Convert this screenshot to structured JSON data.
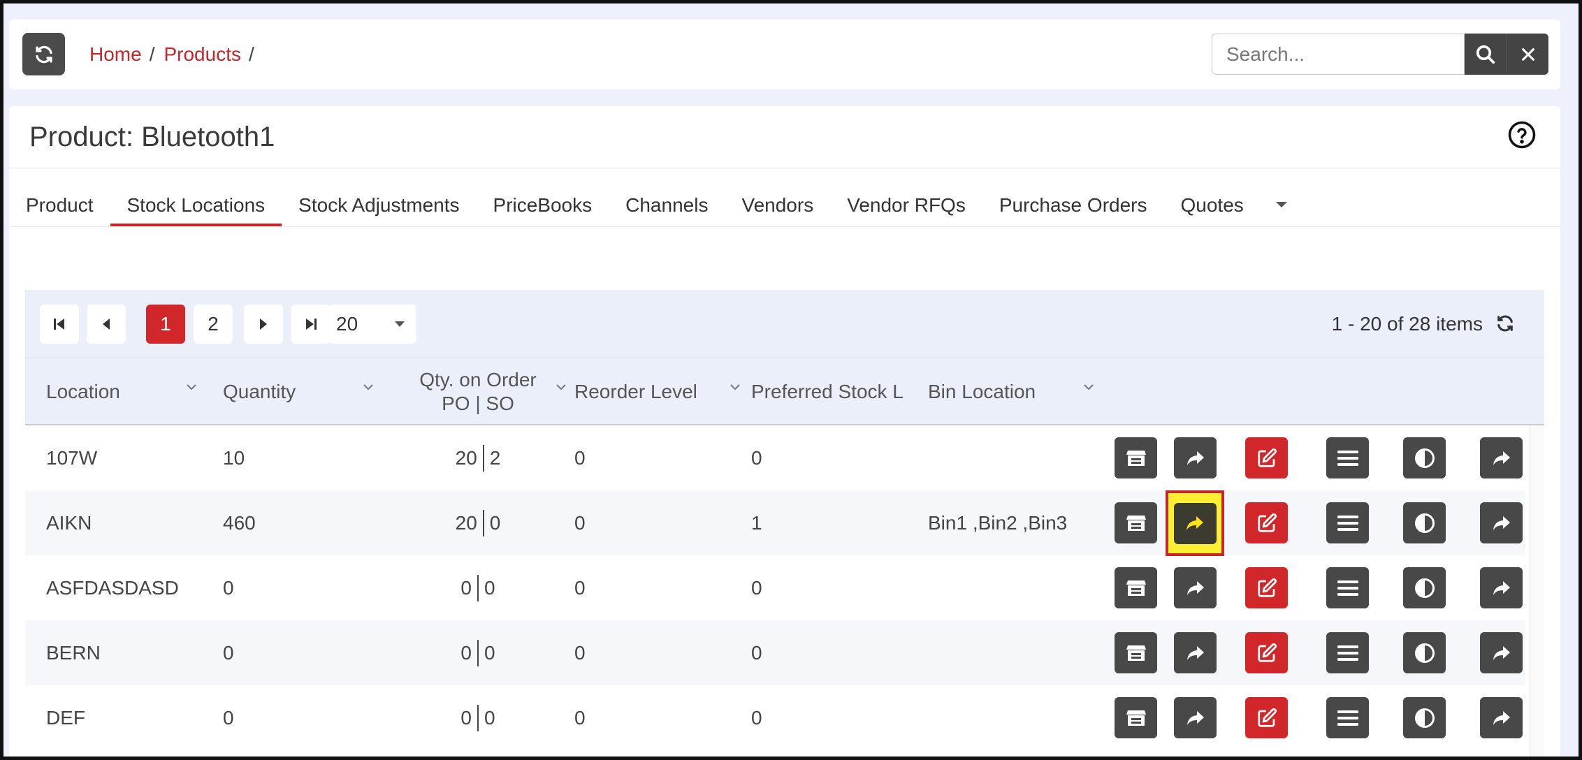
{
  "topbar": {
    "breadcrumb": [
      {
        "label": "Home"
      },
      {
        "label": "Products"
      }
    ],
    "search_placeholder": "Search..."
  },
  "page": {
    "title": "Product: Bluetooth1"
  },
  "tabs": [
    {
      "label": "Product",
      "active": false
    },
    {
      "label": "Stock Locations",
      "active": true
    },
    {
      "label": "Stock Adjustments",
      "active": false
    },
    {
      "label": "PriceBooks",
      "active": false
    },
    {
      "label": "Channels",
      "active": false
    },
    {
      "label": "Vendors",
      "active": false
    },
    {
      "label": "Vendor RFQs",
      "active": false
    },
    {
      "label": "Purchase Orders",
      "active": false
    },
    {
      "label": "Quotes",
      "active": false
    }
  ],
  "pager": {
    "pages": [
      "1",
      "2"
    ],
    "current_page": "1",
    "page_size": "20",
    "info": "1 - 20 of 28 items"
  },
  "columns": {
    "location": "Location",
    "quantity": "Quantity",
    "qty_on_order_line1": "Qty. on Order",
    "qty_on_order_line2": "PO | SO",
    "reorder_level": "Reorder Level",
    "preferred_stock": "Preferred Stock L",
    "bin_location": "Bin Location"
  },
  "rows": [
    {
      "location": "107W",
      "quantity": "10",
      "po": "20",
      "so": "2",
      "reorder": "0",
      "preferred": "0",
      "bin": ""
    },
    {
      "location": "AIKN",
      "quantity": "460",
      "po": "20",
      "so": "0",
      "reorder": "0",
      "preferred": "1",
      "bin": "Bin1 ,Bin2 ,Bin3"
    },
    {
      "location": "ASFDASDASD",
      "quantity": "0",
      "po": "0",
      "so": "0",
      "reorder": "0",
      "preferred": "0",
      "bin": ""
    },
    {
      "location": "BERN",
      "quantity": "0",
      "po": "0",
      "so": "0",
      "reorder": "0",
      "preferred": "0",
      "bin": ""
    },
    {
      "location": "DEF",
      "quantity": "0",
      "po": "0",
      "so": "0",
      "reorder": "0",
      "preferred": "0",
      "bin": ""
    }
  ],
  "colors": {
    "accent": "#c0282b",
    "button_dark": "#484848",
    "button_red": "#d2272a",
    "highlight": "#ffef33"
  },
  "row_actions": [
    "warehouse-icon",
    "share-icon",
    "edit-icon",
    "menu-icon",
    "contrast-icon",
    "share-icon"
  ]
}
